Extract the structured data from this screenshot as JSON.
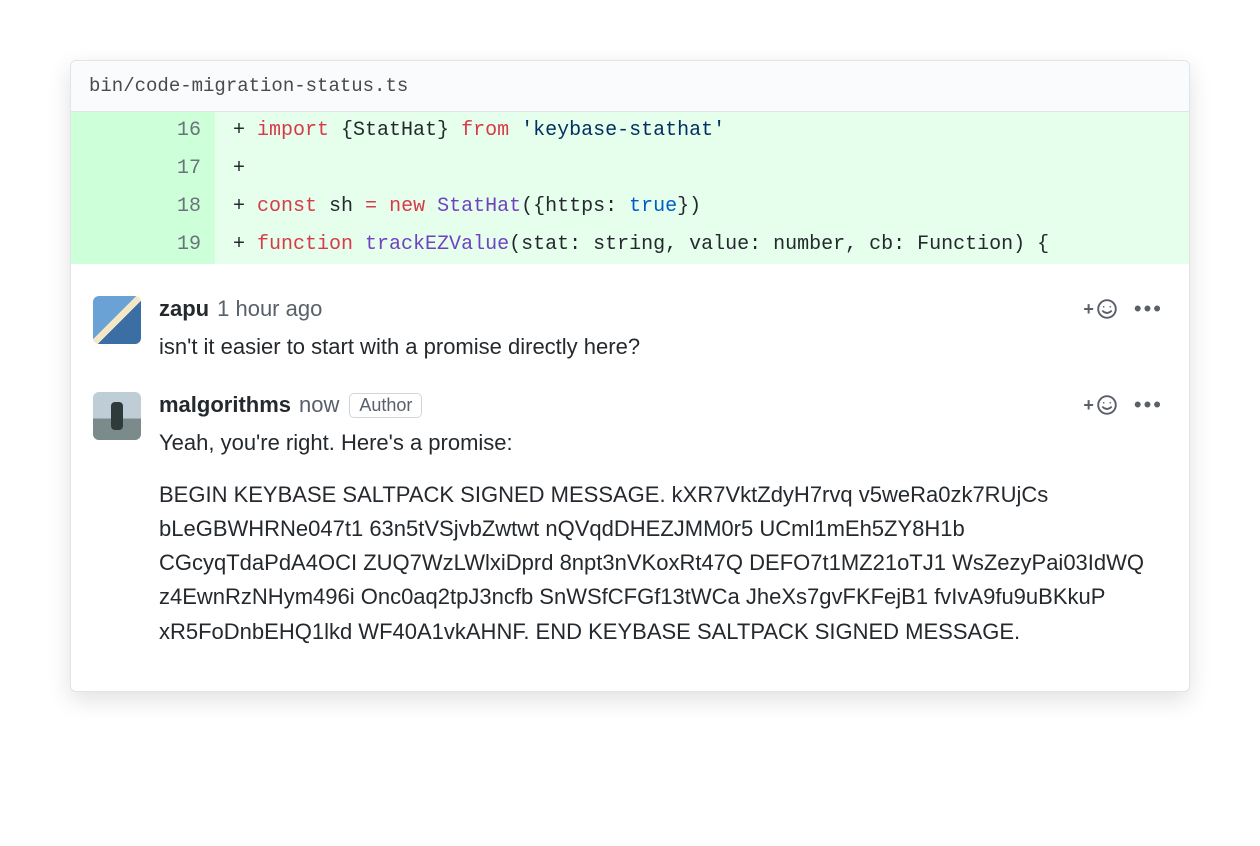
{
  "file": {
    "path": "bin/code-migration-status.ts"
  },
  "diff": {
    "lines": [
      {
        "old": "",
        "new": "16",
        "tokens": [
          {
            "t": "plus",
            "v": "+ "
          },
          {
            "t": "kw-red",
            "v": "import"
          },
          {
            "t": "plain",
            "v": " {StatHat} "
          },
          {
            "t": "kw-red",
            "v": "from"
          },
          {
            "t": "plain",
            "v": " "
          },
          {
            "t": "str-blue",
            "v": "'keybase-stathat'"
          }
        ]
      },
      {
        "old": "",
        "new": "17",
        "tokens": [
          {
            "t": "plus",
            "v": "+ "
          }
        ]
      },
      {
        "old": "",
        "new": "18",
        "tokens": [
          {
            "t": "plus",
            "v": "+ "
          },
          {
            "t": "kw-red",
            "v": "const"
          },
          {
            "t": "plain",
            "v": " sh "
          },
          {
            "t": "kw-red",
            "v": "="
          },
          {
            "t": "plain",
            "v": " "
          },
          {
            "t": "kw-red",
            "v": "new"
          },
          {
            "t": "plain",
            "v": " "
          },
          {
            "t": "fn-purple",
            "v": "StatHat"
          },
          {
            "t": "plain",
            "v": "({https: "
          },
          {
            "t": "lit-blue",
            "v": "true"
          },
          {
            "t": "plain",
            "v": "})"
          }
        ]
      },
      {
        "old": "",
        "new": "19",
        "tokens": [
          {
            "t": "plus",
            "v": "+ "
          },
          {
            "t": "kw-red",
            "v": "function"
          },
          {
            "t": "plain",
            "v": " "
          },
          {
            "t": "fn-purple",
            "v": "trackEZValue"
          },
          {
            "t": "plain",
            "v": "(stat: string, value: number, cb: Function) {"
          }
        ]
      }
    ]
  },
  "comments": [
    {
      "avatarClass": "one",
      "author": "zapu",
      "timestamp": "1 hour ago",
      "badge": null,
      "paragraphs": [
        "isn't it easier to start with a promise directly here?"
      ]
    },
    {
      "avatarClass": "two",
      "author": "malgorithms",
      "timestamp": "now",
      "badge": "Author",
      "paragraphs": [
        "Yeah, you're right. Here's a promise:",
        "BEGIN KEYBASE SALTPACK SIGNED MESSAGE. kXR7VktZdyH7rvq v5weRa0zk7RUjCs bLeGBWHRNe047t1 63n5tVSjvbZwtwt nQVqdDHEZJMM0r5 UCml1mEh5ZY8H1b CGcyqTdaPdA4OCI ZUQ7WzLWlxiDprd 8npt3nVKoxRt47Q DEFO7t1MZ21oTJ1 WsZezyPai03IdWQ z4EwnRzNHym496i Onc0aq2tpJ3ncfb SnWSfCFGf13tWCa JheXs7gvFKFejB1 fvIvA9fu9uBKkuP xR5FoDnbEHQ1lkd WF40A1vkAHNF. END KEYBASE SALTPACK SIGNED MESSAGE."
      ]
    }
  ],
  "icons": {
    "add_reaction_plus": "+"
  }
}
